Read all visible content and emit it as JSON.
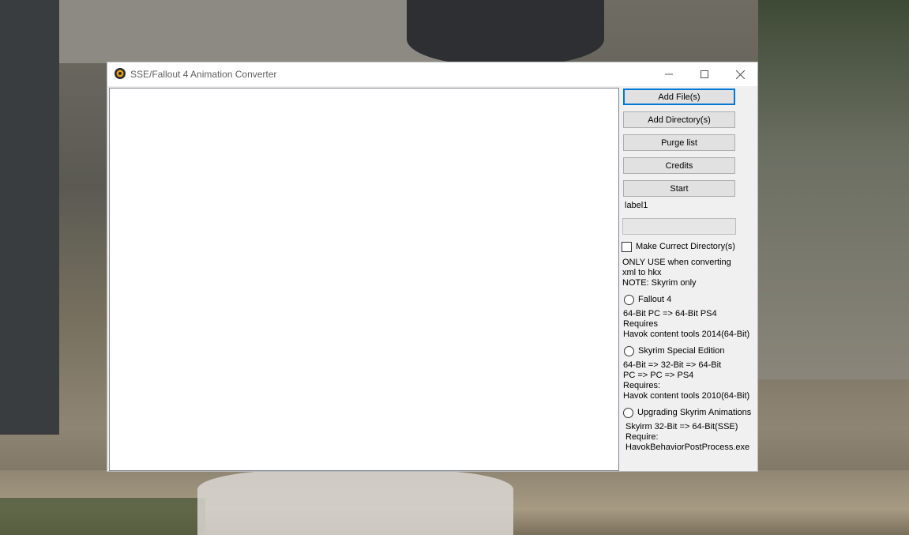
{
  "window": {
    "title": "SSE/Fallout 4 Animation Converter"
  },
  "buttons": {
    "add_files": "Add File(s)",
    "add_directory": "Add Directory(s)",
    "purge_list": "Purge list",
    "credits": "Credits",
    "start": "Start"
  },
  "status_label": "label1",
  "make_current_dir": {
    "label": "Make Currect Directory(s)",
    "checked": false,
    "note_lines": [
      "ONLY USE when converting",
      "xml to hkx",
      "NOTE: Skyrim only"
    ]
  },
  "modes": [
    {
      "label": "Fallout 4",
      "selected": false,
      "desc_lines": [
        "64-Bit PC => 64-Bit PS4",
        "Requires",
        "Havok content tools 2014(64-Bit)"
      ]
    },
    {
      "label": "Skyrim Special Edition",
      "selected": false,
      "desc_lines": [
        "64-Bit  => 32-Bit => 64-Bit",
        "PC => PC => PS4",
        "Requires:",
        "Havok content tools 2010(64-Bit)"
      ]
    },
    {
      "label": "Upgrading Skyrim Animations",
      "selected": false,
      "desc_lines": [
        "Skyirm 32-Bit => 64-Bit(SSE)",
        "Require:",
        "HavokBehaviorPostProcess.exe"
      ]
    }
  ],
  "colors": {
    "accent": "#0078d7",
    "window_bg": "#f0f0f0"
  },
  "icons": [
    "app-icon",
    "minimize-icon",
    "maximize-icon",
    "close-icon"
  ]
}
